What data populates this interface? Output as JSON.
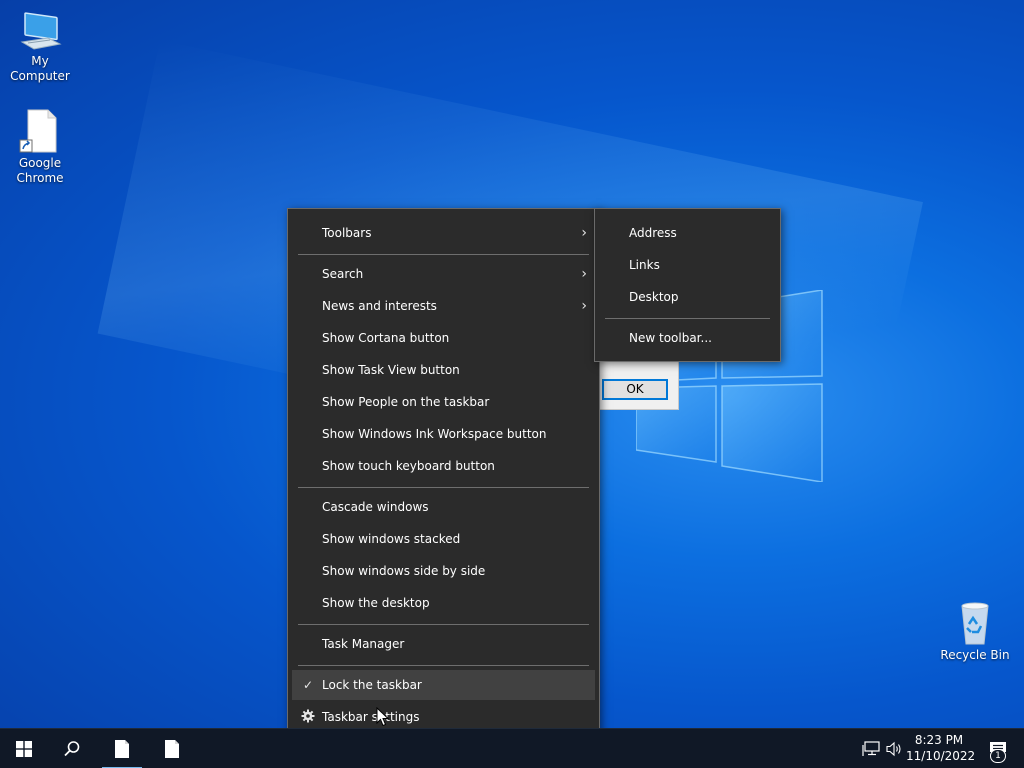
{
  "desktop": {
    "icons": [
      {
        "label": "My Computer"
      },
      {
        "label": "Google\nChrome"
      },
      {
        "label": "Recycle Bin"
      }
    ]
  },
  "dialog": {
    "ok_label": "OK"
  },
  "context_menu": {
    "items": [
      {
        "label": "Toolbars",
        "submenu": true
      },
      {
        "label": "Search",
        "submenu": true
      },
      {
        "label": "News and interests",
        "submenu": true
      },
      {
        "label": "Show Cortana button"
      },
      {
        "label": "Show Task View button"
      },
      {
        "label": "Show People on the taskbar"
      },
      {
        "label": "Show Windows Ink Workspace button"
      },
      {
        "label": "Show touch keyboard button"
      },
      {
        "label": "Cascade windows"
      },
      {
        "label": "Show windows stacked"
      },
      {
        "label": "Show windows side by side"
      },
      {
        "label": "Show the desktop"
      },
      {
        "label": "Task Manager"
      },
      {
        "label": "Lock the taskbar",
        "checked": true,
        "hovered": true
      },
      {
        "label": "Taskbar settings",
        "icon": "gear-icon"
      }
    ]
  },
  "toolbars_submenu": {
    "items": [
      {
        "label": "Address"
      },
      {
        "label": "Links"
      },
      {
        "label": "Desktop"
      },
      {
        "label": "New toolbar..."
      }
    ]
  },
  "taskbar": {
    "time": "8:23 PM",
    "date": "11/10/2022",
    "notification_count": "1"
  },
  "colors": {
    "menu_bg": "#2b2b2b",
    "menu_hover": "#414141",
    "taskbar_bg": "#101826",
    "accent": "#0078d7"
  }
}
